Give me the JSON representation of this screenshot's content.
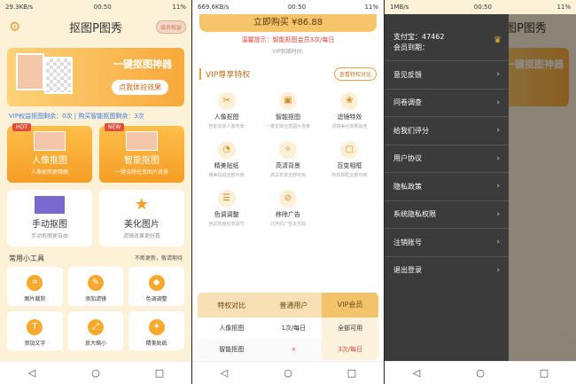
{
  "panel1": {
    "status": {
      "left": "29.3KB/s",
      "time": "00:50",
      "battery": "11%"
    },
    "title": "抠图P图秀",
    "vip_badge": "会员权益",
    "banner": {
      "title": "一键抠图神器",
      "button": "点我体验效果"
    },
    "vip_line": "VIP权益抠图剩余：0次 | 购买智能抠图剩余：3次",
    "cards": [
      {
        "tag": "HOT",
        "title": "人像抠图",
        "sub": "人像抠图更精确"
      },
      {
        "tag": "NEW",
        "title": "智能抠图",
        "sub": "一键去除任意图片背景"
      },
      {
        "tag": "",
        "title": "手动抠图",
        "sub": "手动抠图更自由"
      },
      {
        "tag": "",
        "title": "美化图片",
        "sub": "滤镜效果更好看"
      }
    ],
    "tools_header": "常用小工具",
    "tools_note": "不断更新，敬请期待",
    "tools": [
      {
        "label": "图片裁剪",
        "icon": "crop-icon"
      },
      {
        "label": "添加滤镜",
        "icon": "filter-icon"
      },
      {
        "label": "色调调整",
        "icon": "palette-icon"
      },
      {
        "label": "添加文字",
        "icon": "text-icon"
      },
      {
        "label": "放大缩小",
        "icon": "zoom-icon"
      },
      {
        "label": "精美贴纸",
        "icon": "sticker-icon"
      }
    ]
  },
  "panel2": {
    "status": {
      "left": "669.6KB/s",
      "time": "00:50",
      "battery": "11%"
    },
    "buy_button": "立即购买 ¥86.88",
    "tip": "温馨提示：智能抠图会员3次/每日",
    "expire": "VIP到期时间:",
    "priv_title": "VIP尊享特权",
    "priv_button": "查看特权对比",
    "privileges": [
      {
        "title": "人像抠图",
        "sub": "智能去除人像背景"
      },
      {
        "title": "智能抠图",
        "sub": "一键去除任意图片背景"
      },
      {
        "title": "滤镜特效",
        "sub": "滤镜美化效果最佳"
      },
      {
        "title": "精美贴纸",
        "sub": "精美贴纸全部可用"
      },
      {
        "title": "高清背景",
        "sub": "高清背景全部可用"
      },
      {
        "title": "百变相框",
        "sub": "所有相框全部可用"
      },
      {
        "title": "色调调整",
        "sub": "色调亮度任意调节"
      },
      {
        "title": "移除广告",
        "sub": "讨厌的广告去无踪"
      }
    ],
    "compare": {
      "headers": [
        "特权对比",
        "普通用户",
        "VIP会员"
      ],
      "rows": [
        [
          "人像抠图",
          "1次/每日",
          "全部可用"
        ],
        [
          "智能抠图",
          "×",
          "3次/每日"
        ]
      ]
    }
  },
  "panel3": {
    "status": {
      "left": "1MB/s",
      "time": "00:50",
      "battery": "11%"
    },
    "account_line1": "支付宝：47462",
    "account_line2": "会员到期：",
    "menu": [
      "意见反馈",
      "问卷调查",
      "给我们评分",
      "用户协议",
      "隐私政策",
      "系统隐私权限",
      "注销账号",
      "退出登录"
    ]
  },
  "nav": [
    "◁",
    "○",
    "□"
  ],
  "colors": {
    "accent": "#f59d25",
    "link": "#3a7be0",
    "warning": "#e0453a"
  }
}
